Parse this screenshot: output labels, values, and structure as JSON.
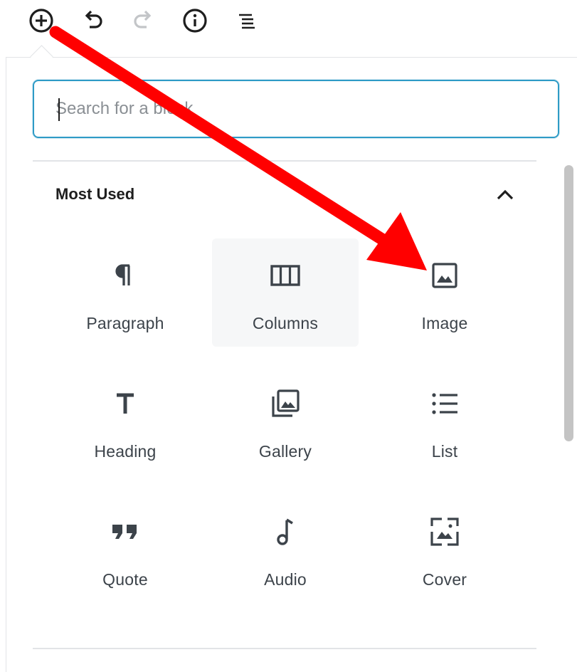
{
  "search": {
    "placeholder": "Search for a block"
  },
  "section": {
    "title": "Most Used"
  },
  "blocks": [
    {
      "label": "Paragraph",
      "icon": "paragraph-icon"
    },
    {
      "label": "Columns",
      "icon": "columns-icon"
    },
    {
      "label": "Image",
      "icon": "image-icon"
    },
    {
      "label": "Heading",
      "icon": "heading-icon"
    },
    {
      "label": "Gallery",
      "icon": "gallery-icon"
    },
    {
      "label": "List",
      "icon": "list-icon"
    },
    {
      "label": "Quote",
      "icon": "quote-icon"
    },
    {
      "label": "Audio",
      "icon": "audio-icon"
    },
    {
      "label": "Cover",
      "icon": "cover-icon"
    }
  ],
  "colors": {
    "focus_border": "#2e9bc6",
    "icon": "#3c434a",
    "annotation_arrow": "#ff0000"
  }
}
